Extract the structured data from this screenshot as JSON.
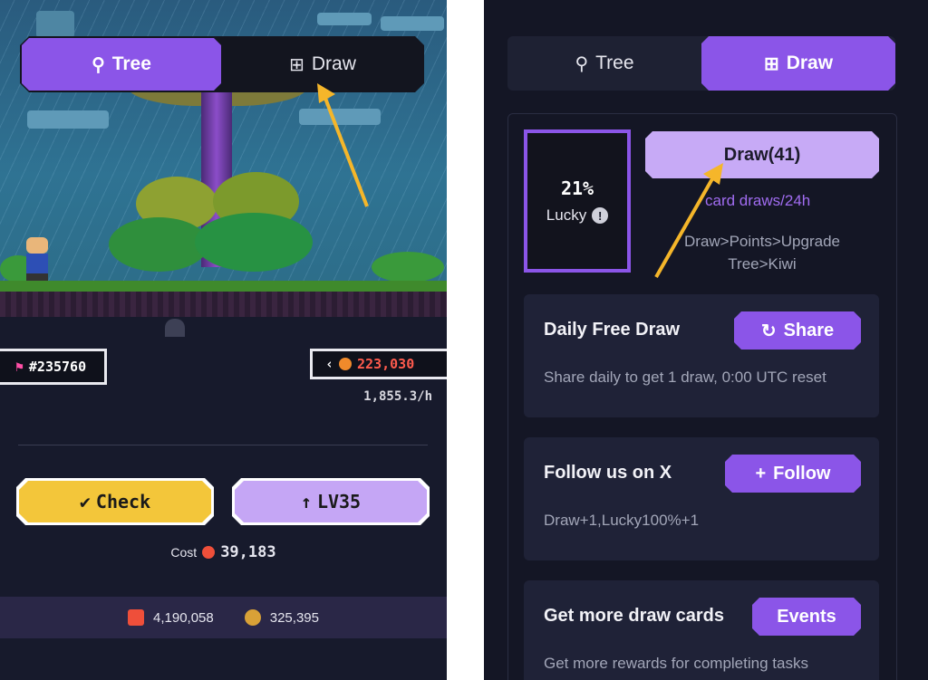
{
  "left": {
    "tabs": {
      "tree_label": "Tree",
      "draw_label": "Draw"
    },
    "player_tag": "#235760",
    "balance": "223,030",
    "rate": "1,855.3/h",
    "check_label": "Check",
    "level_label": "LV35",
    "cost_label": "Cost",
    "cost_value": "39,183",
    "footer": {
      "m_balance": "4,190,058",
      "fruit_balance": "325,395"
    }
  },
  "right": {
    "tabs": {
      "tree_label": "Tree",
      "draw_label": "Draw"
    },
    "lucky_percent": "21%",
    "lucky_label": "Lucky",
    "draw_button": "Draw(41)",
    "draws_info": "card draws/24h",
    "flow_line1": "Draw>Points>Upgrade",
    "flow_line2": "Tree>Kiwi",
    "daily": {
      "title": "Daily Free Draw",
      "button": "Share",
      "desc": "Share daily to get 1 draw, 0:00 UTC reset"
    },
    "follow": {
      "title": "Follow us on X",
      "button": "Follow",
      "desc": "Draw+1,Lucky100%+1"
    },
    "more": {
      "title": "Get more draw cards",
      "button": "Events",
      "desc": "Get more rewards for completing tasks"
    }
  },
  "colors": {
    "accent": "#8b55e8",
    "check_yellow": "#f3c63a",
    "level_lilac": "#c5a6f5",
    "arrow": "#f5b62a",
    "balance_red": "#ff5b4d"
  },
  "icons": [
    "tree-icon",
    "draw-plus-icon",
    "share-icon",
    "follow-plus-icon",
    "check-icon",
    "arrow-up-icon",
    "info-icon",
    "m-coin-icon",
    "kiwi-coin-icon",
    "flag-icon",
    "chevron-left-icon",
    "pointer-arrow"
  ]
}
